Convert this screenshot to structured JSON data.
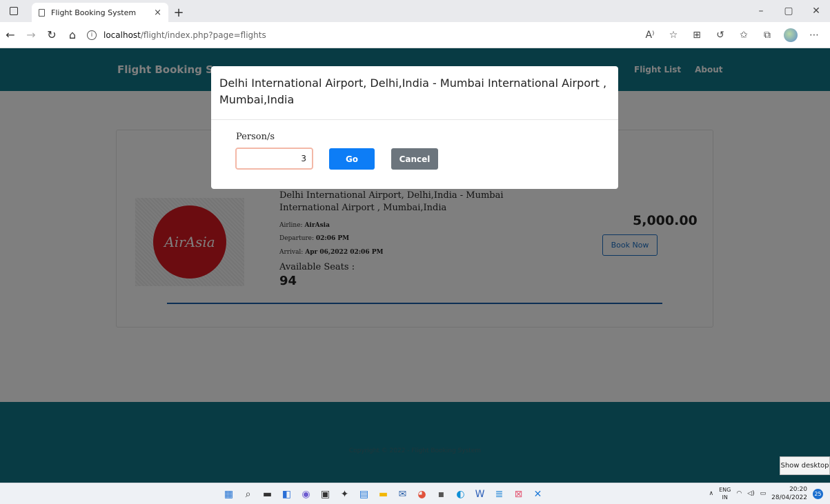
{
  "browser": {
    "tab_title": "Flight Booking System",
    "tab_close": "×",
    "new_tab": "+",
    "url_host": "localhost",
    "url_path": "/flight/index.php?page=flights",
    "minimize": "–",
    "maximize": "▢",
    "close": "✕"
  },
  "site": {
    "brand": "Flight Booking Sys",
    "nav": [
      "Flight List",
      "About"
    ],
    "footer_text": "Copyright © 2022 - Flight Booking System"
  },
  "flight": {
    "route": "Delhi International Airport, Delhi,India - Mumbai International Airport , Mumbai,India",
    "airline_label": "Airline: ",
    "airline": "AirAsia",
    "departure_label": "Departure: ",
    "departure": "02:06 PM",
    "arrival_label": "Arrival: ",
    "arrival": "Apr 06,2022 02:06 PM",
    "seats_label": "Available Seats :",
    "seats": "94",
    "price": "5,000.00",
    "book_label": "Book Now",
    "logo_text": "AirAsia"
  },
  "modal": {
    "title": "Delhi International Airport, Delhi,India - Mumbai International Airport , Mumbai,India",
    "person_label": "Person/s",
    "person_value": "3",
    "go_label": "Go",
    "cancel_label": "Cancel"
  },
  "desktop": {
    "show_desktop": "Show desktop"
  },
  "taskbar": {
    "lang_top": "ENG",
    "lang_bottom": "IN",
    "time": "20:20",
    "date": "28/04/2022",
    "notifications": "25"
  },
  "colors": {
    "nav_bg": "#117788",
    "go_button": "#0d7df6",
    "cancel_button": "#6c757d",
    "airasia_red": "#d71920"
  }
}
